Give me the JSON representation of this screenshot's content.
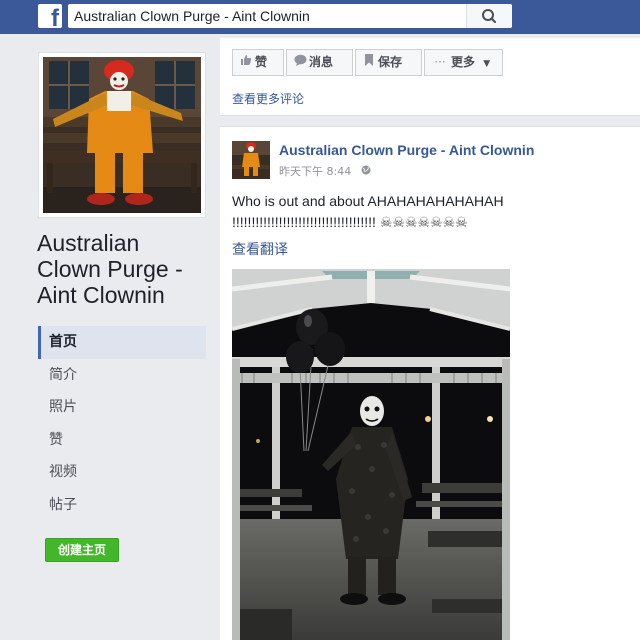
{
  "topbar": {
    "logo": "f",
    "search_value": "Australian Clown Purge - Aint Clownin",
    "search_icon": "search-icon"
  },
  "sidebar": {
    "page_name_lines": [
      "Australian",
      "Clown Purge -",
      "Aint Clownin"
    ],
    "nav_items": [
      {
        "label": "首页",
        "active": true
      },
      {
        "label": "简介"
      },
      {
        "label": "照片"
      },
      {
        "label": "赞"
      },
      {
        "label": "视频"
      },
      {
        "label": "帖子"
      }
    ],
    "create_page_label": "创建主页"
  },
  "actions": {
    "like_label": "赞",
    "message_label": "消息",
    "save_label": "保存",
    "more_label": "更多",
    "more_comments_label": "查看更多评论"
  },
  "post": {
    "author": "Australian Clown Purge - Aint Clownin",
    "time": "昨天下午 8:44",
    "text_line1": "Who is out and about AHAHAHAHAHAHAH",
    "text_line2_exclaims": "!!!!!!!!!!!!!!!!!!!!!!!!!!!!!!!!!!!!!",
    "text_line2_skulls": "☠☠☠☠☠☠☠",
    "translate_label": "查看翻译"
  },
  "colors": {
    "brand": "#3b5998",
    "link": "#365899",
    "create_button": "#42b72a"
  }
}
